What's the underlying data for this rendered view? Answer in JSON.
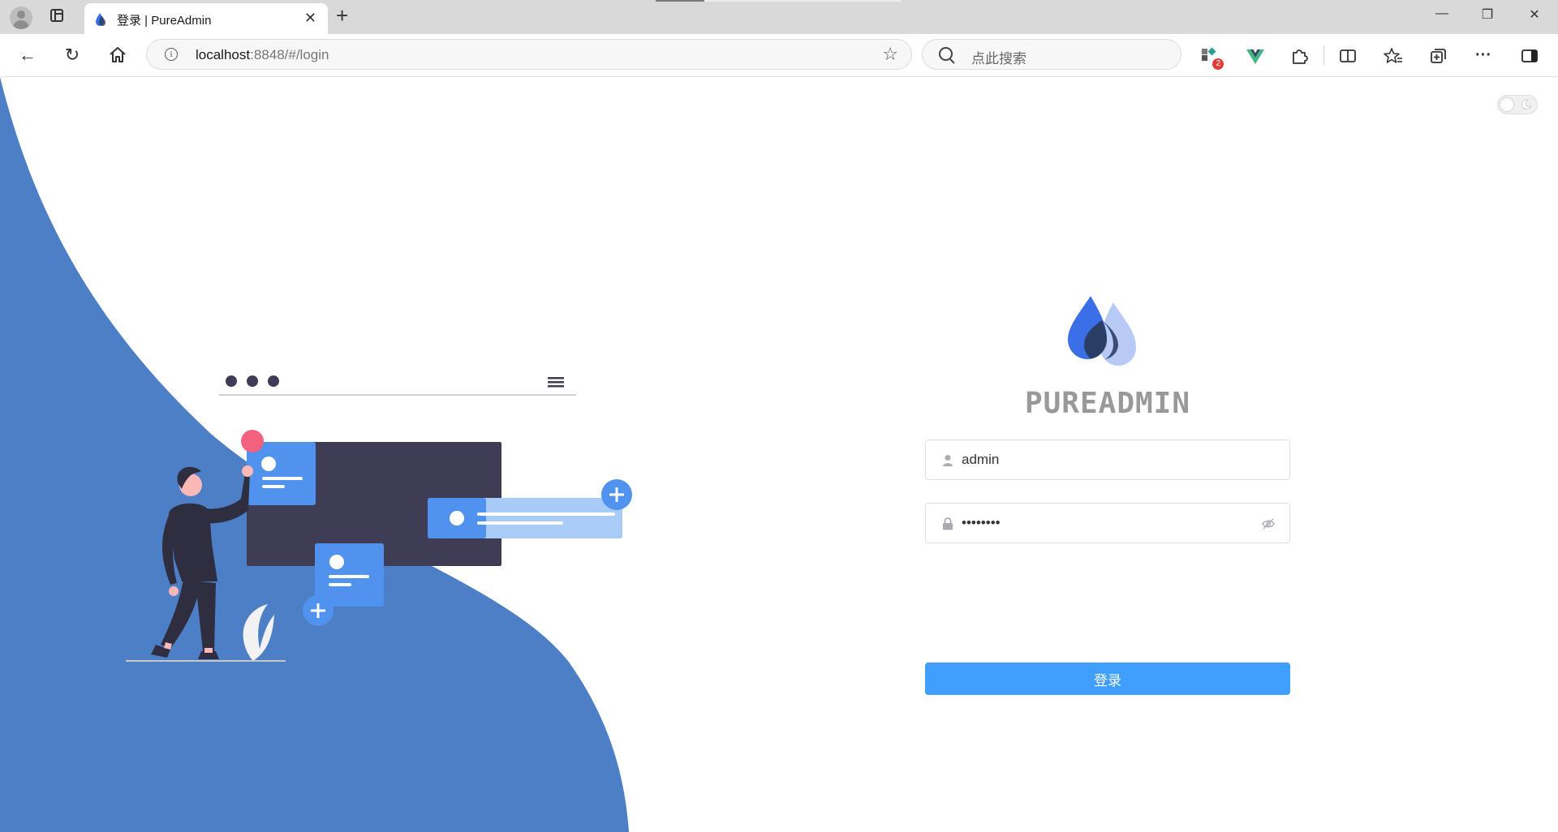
{
  "browser": {
    "tab_title": "登录 | PureAdmin",
    "url_host": "localhost",
    "url_path": ":8848/#/login",
    "search_placeholder": "点此搜索",
    "extension_badge": "2",
    "icons": {
      "profile": "profile-icon",
      "tab_actions": "tab-actions-icon",
      "close_tab": "close-icon",
      "new_tab": "plus-icon",
      "minimize": "minimize-icon",
      "restore": "restore-icon",
      "close_window": "close-icon",
      "back": "back-arrow-icon",
      "refresh": "refresh-icon",
      "home": "home-icon",
      "site_info": "info-icon",
      "favorite": "star-icon",
      "search": "search-icon",
      "extensions": "puzzle-icon",
      "split_screen": "split-screen-icon",
      "favorites": "favorites-icon",
      "collections": "collections-icon",
      "more": "more-icon",
      "sidebar": "sidebar-icon"
    },
    "glyphs": {
      "close": "✕",
      "new_tab": "+",
      "minimize": "—",
      "restore": "❐",
      "back": "←",
      "refresh": "↻",
      "more": "···",
      "star": "☆"
    }
  },
  "login": {
    "brand": "PUREADMIN",
    "username_value": "admin",
    "password_value": "••••••••",
    "submit_label": "登录"
  },
  "colors": {
    "wave": "#4d7fc6",
    "accent": "#409eff",
    "dark_card": "#3f3d56",
    "card_blue": "#4f93ee",
    "card_light": "#a9cbf7",
    "pink_dot": "#f4617f",
    "logo_blue": "#3b6fe8",
    "logo_navy": "#2b3e63",
    "logo_light": "#b7c9f5"
  }
}
